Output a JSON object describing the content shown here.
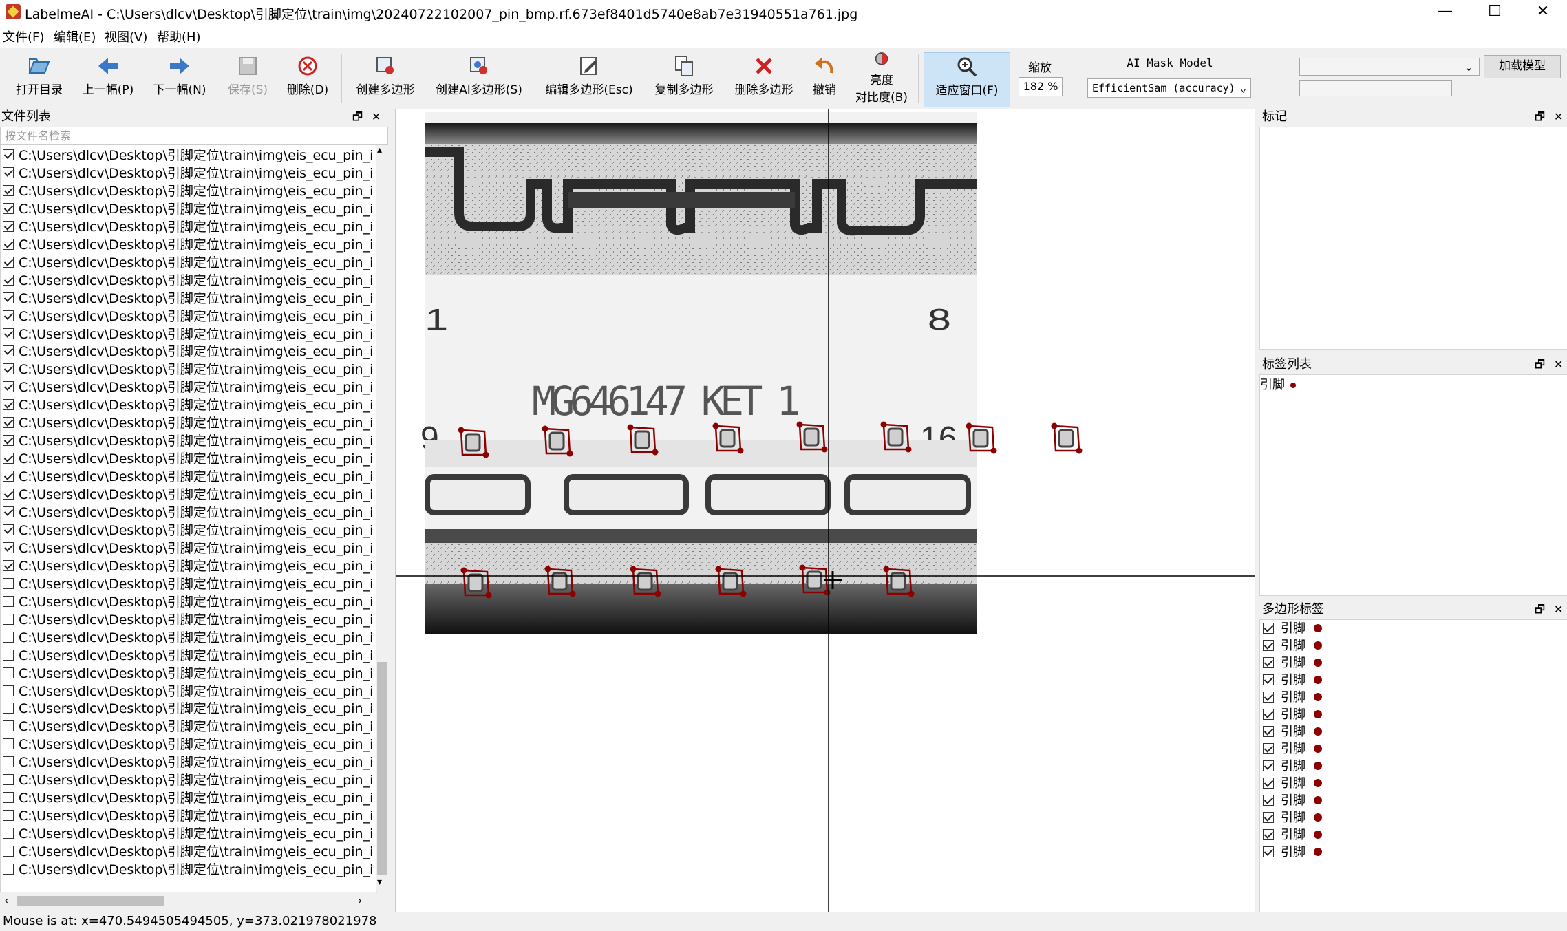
{
  "window": {
    "title": "LabelmeAI - C:\\Users\\dlcv\\Desktop\\引脚定位\\train\\img\\20240722102007_pin_bmp.rf.673ef8401d5740e8ab7e31940551a761.jpg",
    "minimize": "—",
    "maximize": "☐",
    "close": "✕"
  },
  "menu": [
    "文件(F)",
    "编辑(E)",
    "视图(V)",
    "帮助(H)"
  ],
  "toolbar": {
    "open_dir": "打开目录",
    "prev": "上一幅(P)",
    "next": "下一幅(N)",
    "save": "保存(S)",
    "delete": "删除(D)",
    "create_poly": "创建多边形",
    "create_ai_poly": "创建AI多边形(S)",
    "edit_poly": "编辑多边形(Esc)",
    "copy_poly": "复制多边形",
    "delete_poly": "删除多边形",
    "undo": "撤销",
    "brightness_1": "亮度",
    "brightness_2": "对比度(B)",
    "fit_window": "适应窗口(F)",
    "zoom_label": "缩放",
    "zoom_value": "182 %",
    "ai_model_label": "AI Mask Model",
    "ai_model_value": "EfficientSam (accuracy)",
    "load_model": "加载模型"
  },
  "file_panel": {
    "title": "文件列表",
    "search_placeholder": "按文件名检索",
    "item_text": "C:\\Users\\dlcv\\Desktop\\引脚定位\\train\\img\\eis_ecu_pin_inspe",
    "checked": [
      true,
      true,
      true,
      true,
      true,
      true,
      true,
      true,
      true,
      true,
      true,
      true,
      true,
      true,
      true,
      true,
      true,
      true,
      true,
      true,
      true,
      true,
      true,
      true,
      false,
      false,
      false,
      false,
      false,
      false,
      false,
      false,
      false,
      false,
      false,
      false,
      false,
      false,
      false,
      false,
      false
    ]
  },
  "flags_panel": {
    "title": "标记"
  },
  "label_list_panel": {
    "title": "标签列表",
    "items": [
      {
        "label": "引脚",
        "color": "#8b0000"
      }
    ]
  },
  "polygon_panel": {
    "title": "多边形标签",
    "label": "引脚",
    "count": 14,
    "color": "#8b0000"
  },
  "image": {
    "part_text": "MG646147  KET 1",
    "pin_numbers": [
      "1",
      "8",
      "9",
      "16"
    ]
  },
  "status": "Mouse is at: x=470.5494505494505, y=373.021978021978"
}
